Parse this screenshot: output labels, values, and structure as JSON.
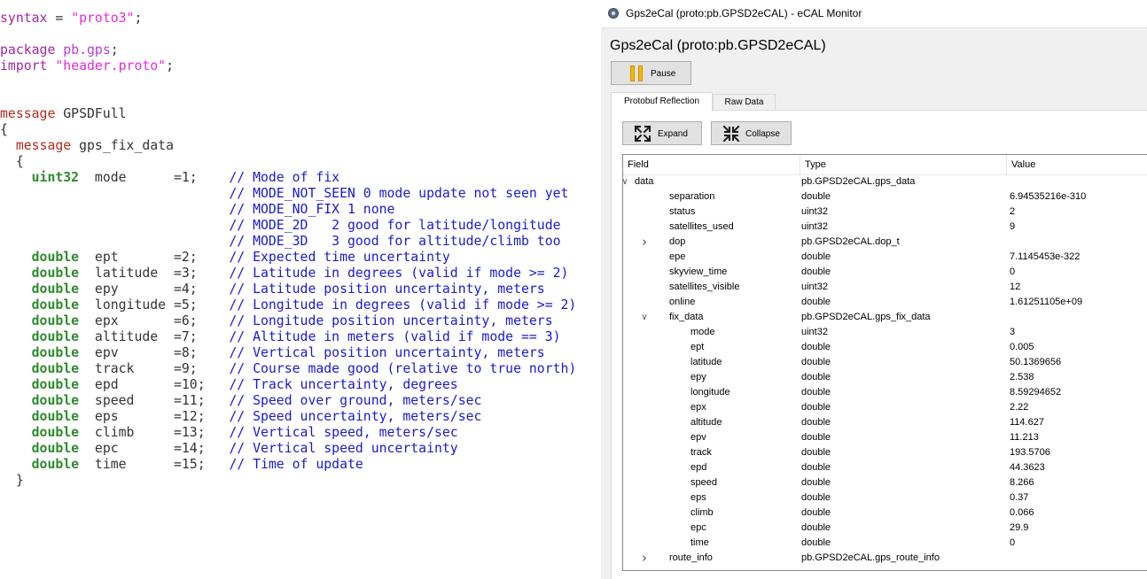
{
  "editor": {
    "lines": [
      [
        {
          "t": "kw",
          "s": "syntax"
        },
        {
          "t": "txt",
          "s": " = "
        },
        {
          "t": "str",
          "s": "\"proto3\""
        },
        {
          "t": "txt",
          "s": ";"
        }
      ],
      [],
      [
        {
          "t": "kw",
          "s": "package"
        },
        {
          "t": "txt",
          "s": " "
        },
        {
          "t": "pkg",
          "s": "pb.gps"
        },
        {
          "t": "txt",
          "s": ";"
        }
      ],
      [
        {
          "t": "kw",
          "s": "import"
        },
        {
          "t": "txt",
          "s": " "
        },
        {
          "t": "str",
          "s": "\"header.proto\""
        },
        {
          "t": "txt",
          "s": ";"
        }
      ],
      [],
      [],
      [
        {
          "t": "message",
          "s": "message"
        },
        {
          "t": "txt",
          "s": " GPSDFull"
        }
      ],
      [
        {
          "t": "txt",
          "s": "{"
        }
      ],
      [
        {
          "t": "txt",
          "s": "  "
        },
        {
          "t": "message",
          "s": "message"
        },
        {
          "t": "txt",
          "s": " gps_fix_data"
        }
      ],
      [
        {
          "t": "txt",
          "s": "  {"
        }
      ],
      [
        {
          "t": "txt",
          "s": "    "
        },
        {
          "t": "type",
          "s": "uint32"
        },
        {
          "t": "txt",
          "s": "  mode      =1;    "
        },
        {
          "t": "com",
          "s": "// Mode of fix"
        }
      ],
      [
        {
          "t": "txt",
          "s": "                             "
        },
        {
          "t": "com",
          "s": "// MODE_NOT_SEEN 0 mode update not seen yet"
        }
      ],
      [
        {
          "t": "txt",
          "s": "                             "
        },
        {
          "t": "com",
          "s": "// MODE_NO_FIX 1 none"
        }
      ],
      [
        {
          "t": "txt",
          "s": "                             "
        },
        {
          "t": "com",
          "s": "// MODE_2D   2 good for latitude/longitude"
        }
      ],
      [
        {
          "t": "txt",
          "s": "                             "
        },
        {
          "t": "com",
          "s": "// MODE_3D   3 good for altitude/climb too"
        }
      ],
      [
        {
          "t": "txt",
          "s": "    "
        },
        {
          "t": "type",
          "s": "double"
        },
        {
          "t": "txt",
          "s": "  ept       =2;    "
        },
        {
          "t": "com",
          "s": "// Expected time uncertainty"
        }
      ],
      [
        {
          "t": "txt",
          "s": "    "
        },
        {
          "t": "type",
          "s": "double"
        },
        {
          "t": "txt",
          "s": "  latitude  =3;    "
        },
        {
          "t": "com",
          "s": "// Latitude in degrees (valid if mode >= 2)"
        }
      ],
      [
        {
          "t": "txt",
          "s": "    "
        },
        {
          "t": "type",
          "s": "double"
        },
        {
          "t": "txt",
          "s": "  epy       =4;    "
        },
        {
          "t": "com",
          "s": "// Latitude position uncertainty, meters"
        }
      ],
      [
        {
          "t": "txt",
          "s": "    "
        },
        {
          "t": "type",
          "s": "double"
        },
        {
          "t": "txt",
          "s": "  longitude =5;    "
        },
        {
          "t": "com",
          "s": "// Longitude in degrees (valid if mode >= 2)"
        }
      ],
      [
        {
          "t": "txt",
          "s": "    "
        },
        {
          "t": "type",
          "s": "double"
        },
        {
          "t": "txt",
          "s": "  epx       =6;    "
        },
        {
          "t": "com",
          "s": "// Longitude position uncertainty, meters"
        }
      ],
      [
        {
          "t": "txt",
          "s": "    "
        },
        {
          "t": "type",
          "s": "double"
        },
        {
          "t": "txt",
          "s": "  altitude  =7;    "
        },
        {
          "t": "com",
          "s": "// Altitude in meters (valid if mode == 3)"
        }
      ],
      [
        {
          "t": "txt",
          "s": "    "
        },
        {
          "t": "type",
          "s": "double"
        },
        {
          "t": "txt",
          "s": "  epv       =8;    "
        },
        {
          "t": "com",
          "s": "// Vertical position uncertainty, meters"
        }
      ],
      [
        {
          "t": "txt",
          "s": "    "
        },
        {
          "t": "type",
          "s": "double"
        },
        {
          "t": "txt",
          "s": "  track     =9;    "
        },
        {
          "t": "com",
          "s": "// Course made good (relative to true north)"
        }
      ],
      [
        {
          "t": "txt",
          "s": "    "
        },
        {
          "t": "type",
          "s": "double"
        },
        {
          "t": "txt",
          "s": "  epd       =10;   "
        },
        {
          "t": "com",
          "s": "// Track uncertainty, degrees"
        }
      ],
      [
        {
          "t": "txt",
          "s": "    "
        },
        {
          "t": "type",
          "s": "double"
        },
        {
          "t": "txt",
          "s": "  speed     =11;   "
        },
        {
          "t": "com",
          "s": "// Speed over ground, meters/sec"
        }
      ],
      [
        {
          "t": "txt",
          "s": "    "
        },
        {
          "t": "type",
          "s": "double"
        },
        {
          "t": "txt",
          "s": "  eps       =12;   "
        },
        {
          "t": "com",
          "s": "// Speed uncertainty, meters/sec"
        }
      ],
      [
        {
          "t": "txt",
          "s": "    "
        },
        {
          "t": "type",
          "s": "double"
        },
        {
          "t": "txt",
          "s": "  climb     =13;   "
        },
        {
          "t": "com",
          "s": "// Vertical speed, meters/sec"
        }
      ],
      [
        {
          "t": "txt",
          "s": "    "
        },
        {
          "t": "type",
          "s": "double"
        },
        {
          "t": "txt",
          "s": "  epc       =14;   "
        },
        {
          "t": "com",
          "s": "// Vertical speed uncertainty"
        }
      ],
      [
        {
          "t": "txt",
          "s": "    "
        },
        {
          "t": "type",
          "s": "double"
        },
        {
          "t": "txt",
          "s": "  time      =15;   "
        },
        {
          "t": "com",
          "s": "// Time of update"
        }
      ],
      [
        {
          "t": "txt",
          "s": "  }"
        }
      ]
    ]
  },
  "monitor": {
    "window_title": "Gps2eCal (proto:pb.GPSD2eCAL) - eCAL Monitor",
    "topic_heading": "Gps2eCal (proto:pb.GPSD2eCAL)",
    "pause_label": "Pause",
    "tabs": [
      "Protobuf Reflection",
      "Raw Data"
    ],
    "active_tab": "Protobuf Reflection",
    "expand_label": "Expand",
    "collapse_label": "Collapse",
    "columns": [
      "Field",
      "Type",
      "Value"
    ],
    "rows": [
      {
        "depth": 0,
        "arrow": "expanded",
        "field": "data",
        "type": "pb.GPSD2eCAL.gps_data",
        "value": ""
      },
      {
        "depth": 1,
        "arrow": "none",
        "field": "separation",
        "type": "double",
        "value": "6.94535216e-310"
      },
      {
        "depth": 1,
        "arrow": "none",
        "field": "status",
        "type": "uint32",
        "value": "2"
      },
      {
        "depth": 1,
        "arrow": "none",
        "field": "satellites_used",
        "type": "uint32",
        "value": "9"
      },
      {
        "depth": 1,
        "arrow": "collapsed",
        "field": "dop",
        "type": "pb.GPSD2eCAL.dop_t",
        "value": ""
      },
      {
        "depth": 1,
        "arrow": "none",
        "field": "epe",
        "type": "double",
        "value": "7.1145453e-322"
      },
      {
        "depth": 1,
        "arrow": "none",
        "field": "skyview_time",
        "type": "double",
        "value": "0"
      },
      {
        "depth": 1,
        "arrow": "none",
        "field": "satellites_visible",
        "type": "uint32",
        "value": "12"
      },
      {
        "depth": 1,
        "arrow": "none",
        "field": "online",
        "type": "double",
        "value": "1.61251105e+09"
      },
      {
        "depth": 1,
        "arrow": "expanded",
        "field": "fix_data",
        "type": "pb.GPSD2eCAL.gps_fix_data",
        "value": ""
      },
      {
        "depth": 2,
        "arrow": "none",
        "field": "mode",
        "type": "uint32",
        "value": "3"
      },
      {
        "depth": 2,
        "arrow": "none",
        "field": "ept",
        "type": "double",
        "value": "0.005"
      },
      {
        "depth": 2,
        "arrow": "none",
        "field": "latitude",
        "type": "double",
        "value": "50.1369656"
      },
      {
        "depth": 2,
        "arrow": "none",
        "field": "epy",
        "type": "double",
        "value": "2.538"
      },
      {
        "depth": 2,
        "arrow": "none",
        "field": "longitude",
        "type": "double",
        "value": "8.59294652"
      },
      {
        "depth": 2,
        "arrow": "none",
        "field": "epx",
        "type": "double",
        "value": "2.22"
      },
      {
        "depth": 2,
        "arrow": "none",
        "field": "altitude",
        "type": "double",
        "value": "114.627"
      },
      {
        "depth": 2,
        "arrow": "none",
        "field": "epv",
        "type": "double",
        "value": "11.213"
      },
      {
        "depth": 2,
        "arrow": "none",
        "field": "track",
        "type": "double",
        "value": "193.5706"
      },
      {
        "depth": 2,
        "arrow": "none",
        "field": "epd",
        "type": "double",
        "value": "44.3623"
      },
      {
        "depth": 2,
        "arrow": "none",
        "field": "speed",
        "type": "double",
        "value": "8.266"
      },
      {
        "depth": 2,
        "arrow": "none",
        "field": "eps",
        "type": "double",
        "value": "0.37"
      },
      {
        "depth": 2,
        "arrow": "none",
        "field": "climb",
        "type": "double",
        "value": "0.066"
      },
      {
        "depth": 2,
        "arrow": "none",
        "field": "epc",
        "type": "double",
        "value": "29.9"
      },
      {
        "depth": 2,
        "arrow": "none",
        "field": "time",
        "type": "double",
        "value": "0"
      },
      {
        "depth": 1,
        "arrow": "collapsed",
        "field": "route_info",
        "type": "pb.GPSD2eCAL.gps_route_info",
        "value": ""
      }
    ],
    "icons": {
      "app": "ecal-monitor-icon",
      "pause": "pause-icon",
      "expand": "expand-arrows-icon",
      "collapse": "collapse-arrows-icon",
      "tree_expanded": "chevron-down-icon",
      "tree_collapsed": "chevron-right-icon"
    },
    "colors": {
      "pause_icon": "#f5b800",
      "code_keyword": "#a626a4",
      "code_string": "#e32ad7",
      "code_type": "#2e8b2e",
      "code_comment": "#1a1acc"
    }
  }
}
